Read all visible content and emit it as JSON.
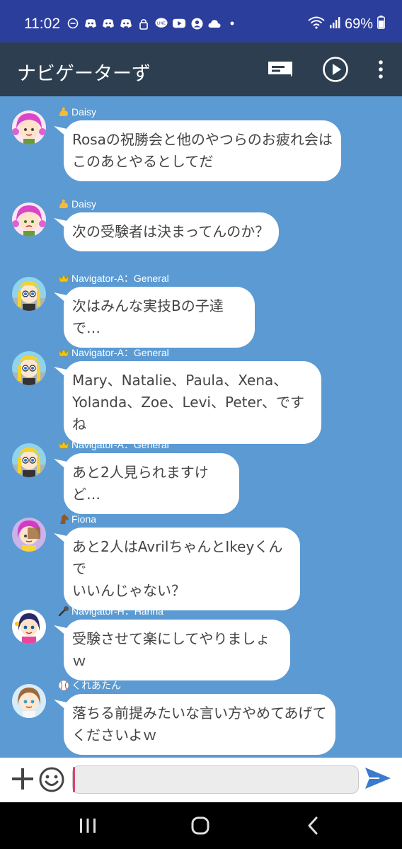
{
  "status": {
    "time": "11:02",
    "battery": "69%",
    "icons": [
      "do-not-disturb-icon",
      "discord-icon",
      "discord-icon",
      "discord-icon",
      "lock-icon",
      "line-icon",
      "youtube-icon",
      "account-icon",
      "cloud-icon",
      "dot-icon"
    ]
  },
  "app": {
    "title": "ナビゲーターず",
    "accent": "#2d3e50"
  },
  "messages": [
    {
      "sender": "Daisy",
      "badge": "flexed-biceps-icon",
      "text": "Rosaの祝勝会と他のやつらのお疲れ会は\nこのあとやるとしてだ",
      "avatar": "daisy-avatar"
    },
    {
      "sender": "Daisy",
      "badge": "flexed-biceps-icon",
      "text": "次の受験者は決まってんのか？",
      "avatar": "daisy-avatar"
    },
    {
      "sender": "Navigator-A：General",
      "badge": "crown-icon",
      "text": "次はみんな実技Bの子達で…",
      "avatar": "navigator-a-avatar"
    },
    {
      "sender": "Navigator-A：General",
      "badge": "crown-icon",
      "text": "Mary、Natalie、Paula、Xena、\nYolanda、Zoe、Levi、Peter、ですね",
      "avatar": "navigator-a-avatar"
    },
    {
      "sender": "Navigator-A：General",
      "badge": "crown-icon",
      "text": "あと2人見られますけど…",
      "avatar": "navigator-a-avatar"
    },
    {
      "sender": "Fiona",
      "badge": "horse-icon",
      "text": "あと2人はAvrilちゃんとIkeyくんで\nいいんじゃない？",
      "avatar": "fiona-avatar"
    },
    {
      "sender": "Navigator-H：Hanna",
      "badge": "microphone-icon",
      "text": "受験させて楽にしてやりましょｗ",
      "avatar": "hanna-avatar"
    },
    {
      "sender": "くれあたん",
      "badge": "baseball-icon",
      "text": "落ちる前提みたいな言い方やめてあげて\nくださいよｗ",
      "avatar": "kureatan-avatar"
    }
  ],
  "composer": {
    "placeholder": ""
  }
}
